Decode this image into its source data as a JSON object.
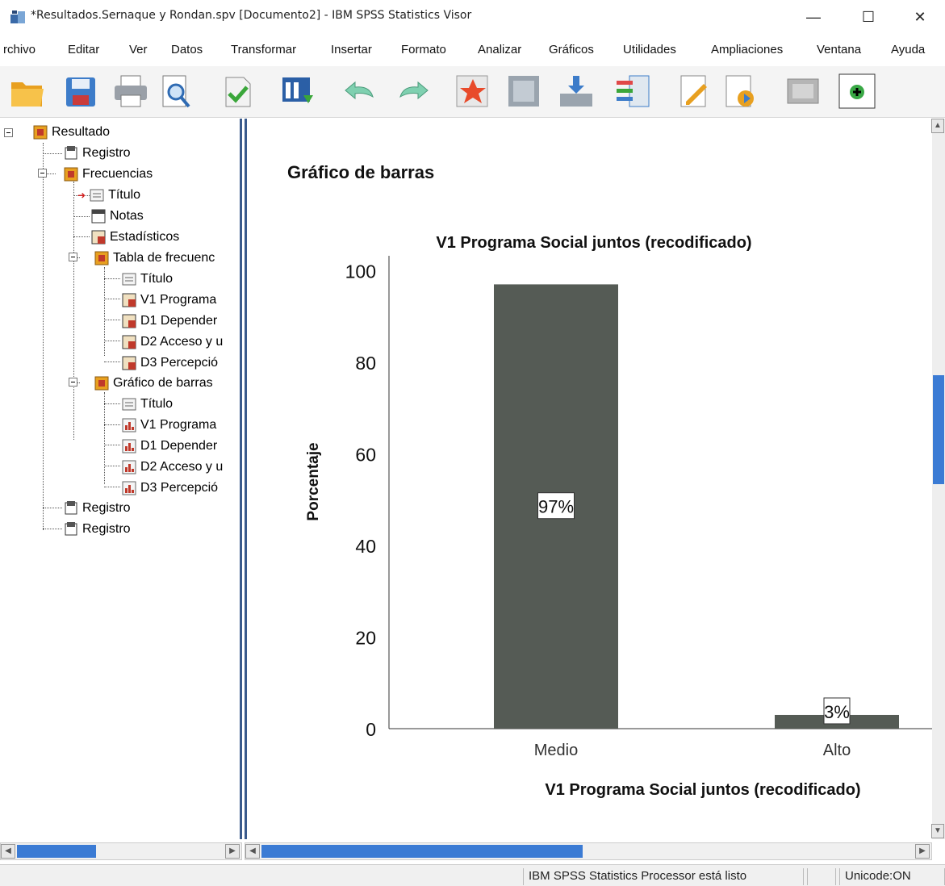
{
  "window": {
    "title": "*Resultados.Sernaque y Rondan.spv [Documento2] - IBM SPSS Statistics Visor",
    "minimize_glyph": "—",
    "maximize_glyph": "☐",
    "close_glyph": "✕"
  },
  "menu": {
    "items": [
      {
        "label": "Archivo",
        "display": "rchivo"
      },
      {
        "label": "Editar"
      },
      {
        "label": "Ver"
      },
      {
        "label": "Datos"
      },
      {
        "label": "Transformar"
      },
      {
        "label": "Insertar"
      },
      {
        "label": "Formato"
      },
      {
        "label": "Analizar"
      },
      {
        "label": "Gráficos"
      },
      {
        "label": "Utilidades"
      },
      {
        "label": "Ampliaciones"
      },
      {
        "label": "Ventana"
      },
      {
        "label": "Ayuda"
      }
    ]
  },
  "toolbar": {
    "icons": [
      "open-folder-icon",
      "save-icon",
      "print-icon",
      "print-preview-icon",
      "export-icon",
      "recall-dialog-icon",
      "undo-icon",
      "redo-icon",
      "goto-case-icon",
      "goto-variable-icon",
      "insert-icon",
      "select-icon",
      "edit-icon",
      "show-icon",
      "designate-window-icon",
      "add-icon"
    ]
  },
  "outline": {
    "items": [
      {
        "label": "Resultado"
      },
      {
        "label": "Registro"
      },
      {
        "label": "Frecuencias"
      },
      {
        "label": "Título"
      },
      {
        "label": "Notas"
      },
      {
        "label": "Estadísticos"
      },
      {
        "label": "Tabla de frecuenc"
      },
      {
        "label": "Título"
      },
      {
        "label": "V1 Programa"
      },
      {
        "label": "D1 Depender"
      },
      {
        "label": "D2 Acceso y u"
      },
      {
        "label": "D3 Percepció"
      },
      {
        "label": "Gráfico de barras"
      },
      {
        "label": "Título"
      },
      {
        "label": "V1 Programa"
      },
      {
        "label": "D1 Depender"
      },
      {
        "label": "D2 Acceso y u"
      },
      {
        "label": "D3 Percepció"
      },
      {
        "label": "Registro"
      },
      {
        "label": "Registro"
      }
    ]
  },
  "content": {
    "section_title": "Gráfico de barras"
  },
  "chart_data": {
    "type": "bar",
    "title": "V1 Programa Social juntos (recodificado)",
    "xlabel": "V1 Programa Social juntos (recodificado)",
    "ylabel": "Porcentaje",
    "categories": [
      "Medio",
      "Alto"
    ],
    "values": [
      97,
      3
    ],
    "data_labels": [
      "97%",
      "3%"
    ],
    "ylim": [
      0,
      105
    ],
    "yticks": [
      "0",
      "20",
      "40",
      "60",
      "80",
      "100"
    ],
    "grid": false,
    "bar_color": "#555b55"
  },
  "statusbar": {
    "processor_status": "IBM SPSS Statistics Processor está listo",
    "unicode": "Unicode:ON"
  }
}
